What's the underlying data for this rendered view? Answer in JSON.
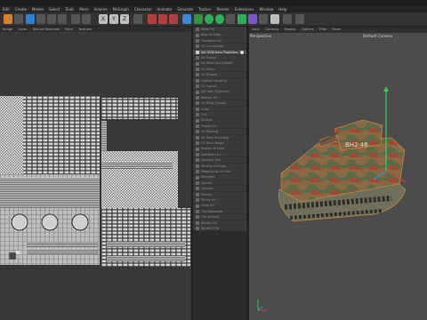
{
  "window": {
    "title": "Maxon"
  },
  "menubar": {
    "items": [
      "Edit",
      "Create",
      "Modes",
      "Select",
      "Tools",
      "Mesh",
      "Volume",
      "MoGraph",
      "Character",
      "Animate",
      "Simulate",
      "Tracker",
      "Render",
      "Extensions",
      "Window",
      "Help"
    ]
  },
  "uv_editor": {
    "menu": [
      "Image",
      "Layer",
      "Texture Selection",
      "Paint",
      "Textures"
    ]
  },
  "uv_commands": {
    "items": [
      "Relax UV",
      "Align to Edge",
      "Transform UV",
      "UV Commands",
      "Set UVW from Projection",
      "UV Project",
      "UV Relax and Optimi",
      "UV Mirror",
      "UV Terrace",
      "Optimal Mapping",
      "UV Layout",
      "Set from Projection",
      "Realign UV",
      "UV Fit to Canvas",
      "Cube",
      "Flat",
      "Normal",
      "Project UV",
      "UV Packing",
      "UV Pack Bounding",
      "UV Pack Shape",
      "Realign to Face",
      "Distribute UV",
      "Equalize Size",
      "Packing Settings",
      "Mapping to UV Grid",
      "Reproject",
      "Sphere",
      "Cylinder",
      "Frontal",
      "Shrink UV",
      "Grow UV",
      "Flip Horizontal",
      "Flip Vertical",
      "Rotate CW",
      "Rotate CCW"
    ],
    "active_index": 4
  },
  "viewport": {
    "menu": [
      "View",
      "Cameras",
      "Display",
      "Options",
      "Filter",
      "Panel"
    ],
    "name": "Perspective",
    "camera": "Default Camera",
    "tank_label": "BH2·46"
  },
  "colors": {
    "uv_background": "#383838",
    "viewport_background": "#4c4c4c",
    "axis_y": "#2fd05a",
    "axis_x": "#d24a3a",
    "axis_z": "#2f8fe0"
  }
}
